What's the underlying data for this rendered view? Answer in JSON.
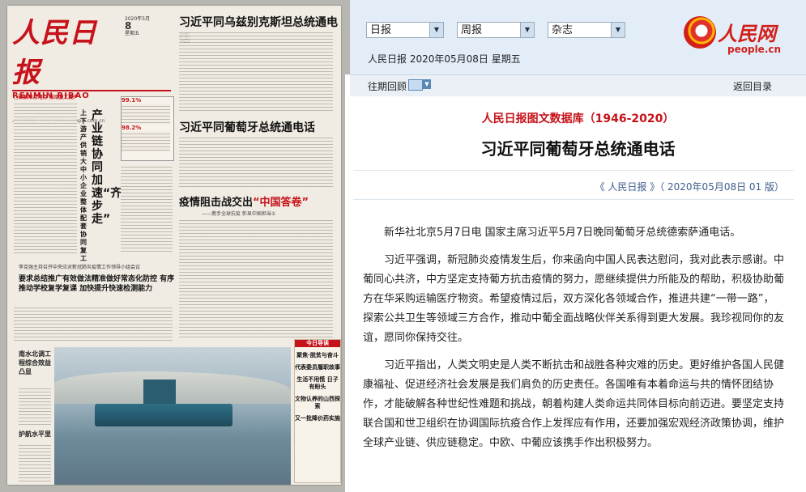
{
  "newspaper": {
    "masthead": "人民日报",
    "masthead_en": "RENMIN RIBAO",
    "url": "人民网网址：http://www.people.com.cn",
    "date_year": "2020年5月",
    "date_day": "8",
    "date_week": "星期五",
    "headline1": "习近平同乌兹别克斯坦总统通电话",
    "headline2": "习近平同葡萄牙总统通电话",
    "headline3_prefix": "疫情阻击战交出",
    "headline3_quote": "“中国答卷”",
    "headline3_sub": "——携手全球抗疫 彰显中国担当①",
    "left_kicker": "□破解难点堵点 推动复工复产",
    "vertical_headline": "产业链协同加速“齐步走”",
    "vertical_sub": "上下游产供销大中小企业整体配套协同复工",
    "box_pct1": "99.1%",
    "box_pct2": "98.2%",
    "mid_kicker": "李克强主持召开中央应对新冠肺炎疫情工作领导小组会议",
    "mid_headline": "要求总结推广有效做法精准做好常态化防控 有序推动学校复学复课 加快提升快速检测能力",
    "photo_caption_head": "南水北调工程综合效益凸显",
    "photo_caption2": "护航水平里",
    "sidebar_title": "今日导读",
    "sidebar_items": [
      "聚焦·脱贫与奋斗",
      "代表委员履职故事",
      "生活不用慌 日子有盼头",
      "文物认养的山西探索",
      "又一批降价药实施"
    ]
  },
  "topbar": {
    "select_daily": "日报",
    "select_weekly": "周报",
    "select_magazine": "杂志",
    "dateline": "人民日报 2020年05月08日 星期五",
    "logo_name": "人民网",
    "logo_url": "people.cn"
  },
  "nav": {
    "past_label": "往期回顾",
    "back_label": "返回目录"
  },
  "article": {
    "database": "人民日报图文数据库（1946-2020）",
    "title": "习近平同葡萄牙总统通电话",
    "meta": "《 人民日报 》（ 2020年05月08日   01 版）",
    "paragraphs": [
      "新华社北京5月7日电  国家主席习近平5月7日晚同葡萄牙总统德索萨通电话。",
      "习近平强调，新冠肺炎疫情发生后，你来函向中国人民表达慰问，我对此表示感谢。中葡同心共济，中方坚定支持葡方抗击疫情的努力，愿继续提供力所能及的帮助，积极协助葡方在华采购运输医疗物资。希望疫情过后，双方深化各领域合作，推进共建“一带一路”，探索公共卫生等领域三方合作，推动中葡全面战略伙伴关系得到更大发展。我珍视同你的友谊，愿同你保持交往。",
      "习近平指出，人类文明史是人类不断抗击和战胜各种灾难的历史。更好维护各国人民健康福祉、促进经济社会发展是我们肩负的历史责任。各国唯有本着命运与共的情怀团结协作，才能破解各种世纪性难题和挑战，朝着构建人类命运共同体目标向前迈进。要坚定支持联合国和世卫组织在协调国际抗疫合作上发挥应有作用，还要加强宏观经济政策协调，维护全球产业链、供应链稳定。中欧、中葡应该携手作出积极努力。"
    ]
  }
}
